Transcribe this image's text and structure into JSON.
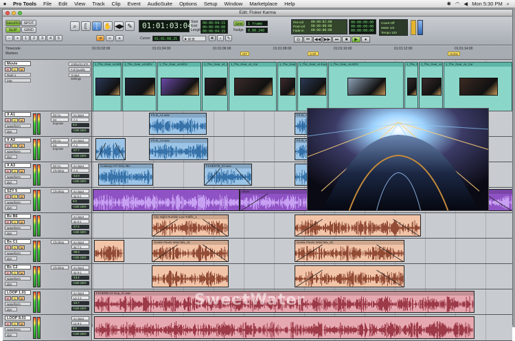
{
  "menubar": {
    "apple": "",
    "items": [
      "Pro Tools",
      "File",
      "Edit",
      "View",
      "Track",
      "Clip",
      "Event",
      "AudioSuite",
      "Options",
      "Setup",
      "Window",
      "Marketplace",
      "Help"
    ],
    "clock": "Mon 5:30 PM"
  },
  "window": {
    "title": "Edit: Fisker Karma"
  },
  "toolbar": {
    "mode_buttons": [
      "SHUFFLE",
      "SPOT",
      "SLIP",
      "GRID"
    ],
    "main_counter": "01:01:03:04",
    "start": "Start",
    "end": "End",
    "length": "Length",
    "start_val": "00:00:04:15",
    "end_val": "00:00:00:00",
    "length_val": "00:00:04:15",
    "cursor_label": "Cursor",
    "cursor_val": "01:01:08:25",
    "grid_label": "Grid",
    "grid_val": "1 frame",
    "nudge_label": "Nudge",
    "nudge_val": "0.00.240",
    "pre_roll": "Pre-roll",
    "post_roll": "Post-roll",
    "fade_in": "Fade-in",
    "pre_val": "00:00:02:00",
    "post_val": "00:00:00:00",
    "fade_val": "00:00:00:00",
    "tc_start": "00:00:00:00",
    "tc_end": "00:00:00:00",
    "tc_len": "00:00:00:00",
    "count_off": "Count Off",
    "meter": "Meter",
    "tempo": "Tempo",
    "tempo_val": "120",
    "meter_val": "4/4"
  },
  "ruler": {
    "timecode_label": "Timecode",
    "markers_label": "Markers",
    "ticks": [
      "01:01:02:00",
      "01:01:04:00",
      "01:01:06:00",
      "01:01:08:00",
      "01:01:10:00",
      "01:01:12:00",
      "01:01:14:00"
    ],
    "markers": [
      "HIT",
      "CAR",
      "Home"
    ]
  },
  "tracks": [
    {
      "name": "Movie",
      "type": "video",
      "sub": "Reel 1",
      "rate": "24p",
      "io_a": "1080p/23.976",
      "io_b": "Full Quality",
      "io_c": "Output Settings"
    },
    {
      "name": "X A1",
      "type": "audio",
      "io_a": "no input",
      "io_b": "A 1",
      "plugin": "D3 CL",
      "plugin2": "D3 Expnder",
      "tag": "waveform",
      "tag2": "dyn",
      "vol": "0.0",
      "pan": "<100 100>"
    },
    {
      "name": "X A2",
      "type": "audio",
      "io_a": "no input",
      "io_b": "A 2",
      "plugin": "D3 CL",
      "plugin2": "D3 Expnder",
      "tag": "waveform",
      "tag2": "dyn",
      "vol": "-27.7",
      "pan": "<100 100>"
    },
    {
      "name": "X A3",
      "type": "audio",
      "io_a": "no input",
      "io_b": "A 3",
      "plugin": "D3 CL",
      "plugin2": "ChnlStrp",
      "tag": "waveform",
      "tag2": "dyn",
      "vol": "-12.0",
      "pan": "<100 100>"
    },
    {
      "name": "SZY 5",
      "type": "audio",
      "io_a": "no input",
      "io_b": "sp 5-1",
      "plugin": "ChnlStrp",
      "tag": "waveform",
      "tag2": "dyn",
      "vol": "0.0",
      "pan": "<100 100>"
    },
    {
      "name": "Bx B6",
      "type": "audio",
      "io_a": "no input",
      "io_b": "sp 6-1",
      "plugin": "",
      "tag": "waveform",
      "tag2": "dyn",
      "vol": "-17.4",
      "pan": "<100 100>"
    },
    {
      "name": "Bx C1",
      "type": "audio",
      "io_a": "no input",
      "io_b": "sp 7-1",
      "plugin": "ChnlStrp",
      "tag": "waveform",
      "tag2": "dyn",
      "vol": "-30.0",
      "pan": "<100 100>"
    },
    {
      "name": "Bx C2",
      "type": "audio",
      "io_a": "no input",
      "io_b": "sp 8-1",
      "plugin": "ChnlStrp",
      "tag": "waveform",
      "tag2": "dyn",
      "vol": "-13.4",
      "pan": "<100 100>"
    },
    {
      "name": "LOOP 1.01",
      "type": "audio",
      "io_a": "no input",
      "io_b": "Lp 1-1",
      "plugin": "",
      "tag": "waveform",
      "tag2": "dyn",
      "vol": "-10.7",
      "pan": "<100 100>"
    },
    {
      "name": "LOOP 8.01",
      "type": "audio",
      "io_a": "no input",
      "io_b": "Lp 8-1",
      "plugin": "",
      "tag": "waveform",
      "tag2": "dyn",
      "vol": "0.0",
      "pan": "<100 100>"
    }
  ],
  "video_clips": [
    "1_The_Gear_v4.MOV",
    "1_The_Gear_v4.MOV",
    "1_The_Gear_v4.MOV",
    "1_The_Gear_v4_Car",
    "1_The_Gear_v4_Car",
    "1_The_Gear_v4_Car",
    "1_The_Gear_v4 Exported 01"
  ],
  "audio_clips": {
    "a1": [
      "FX-B_A1.wav",
      "FX-B_A1.wav"
    ],
    "a2": [
      "FX-B_A2.wav",
      "FX-B_A2.wav"
    ],
    "a3": [
      "Cutaway HIT Dirty Mix",
      "FXHERTB_03.wav"
    ],
    "szy": [
      "Glass"
    ],
    "bxb6": [
      "City Night Rumble Low Traffic_1"
    ],
    "bxc1": [
      "Gentle Pinelo Wind Mix_01",
      "Gentle Pinelo Wind Mix_02"
    ],
    "loop1": [
      "FXHERB-1X loop_01.wav"
    ]
  },
  "colors": {
    "video_clip": "#8ad6c9",
    "audio_blue": "#9cc4e6",
    "audio_purple": "#8f52c4",
    "audio_salmon": "#f2c5a9",
    "audio_pink": "#e7a9b1"
  },
  "watermark": "SweetWater"
}
